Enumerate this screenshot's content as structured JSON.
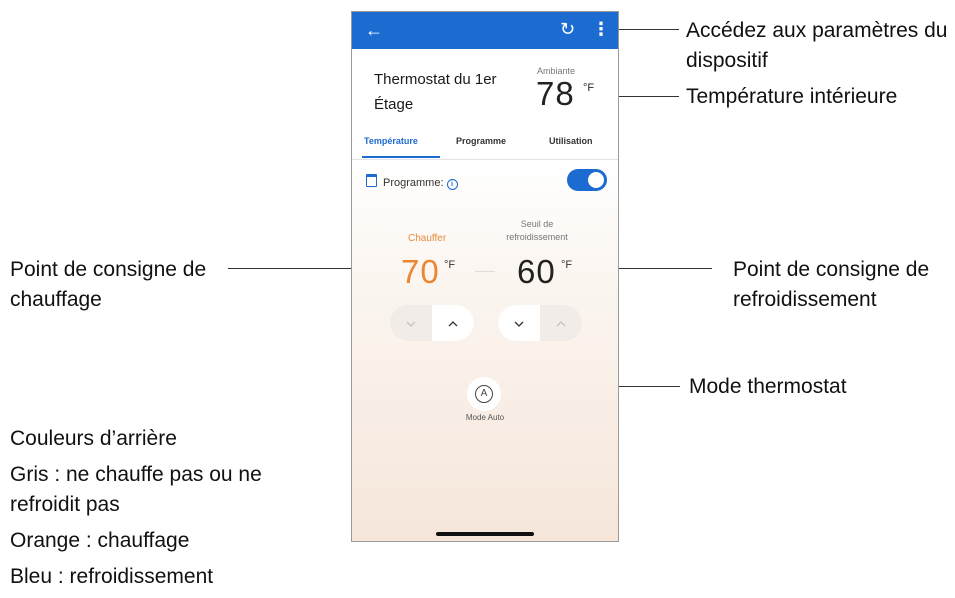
{
  "colors": {
    "accent": "#1c6bd0",
    "heat": "#ec8632"
  },
  "annotations": {
    "settings": "Accédez aux paramètres du dispositif",
    "indoor_temp": "Température intérieure",
    "heat_setpoint": "Point de consigne de chauffage",
    "cool_setpoint": "Point de consigne de refroidissement",
    "mode": "Mode thermostat"
  },
  "legend": {
    "title": "Couleurs d’arrière",
    "gray": "Gris : ne chauffe pas ou ne refroidit pas",
    "orange": "Orange : chauffage",
    "blue": "Bleu : refroidissement"
  },
  "app": {
    "appbar": {
      "back_icon": "←",
      "refresh_icon": "↻",
      "more_icon": "⋮"
    },
    "device_name": "Thermostat du 1er Étage",
    "ambient_label": "Ambiante",
    "ambient_value": "78",
    "unit": "°F",
    "tabs": [
      "Température",
      "Programme",
      "Utilisation"
    ],
    "schedule_label": "Programme:",
    "schedule_enabled": true,
    "heat": {
      "label": "Chauffer",
      "value": "70"
    },
    "cool": {
      "label": "Seuil de refroidissement",
      "value": "60"
    },
    "mode_letter": "A",
    "mode_label": "Mode Auto"
  }
}
